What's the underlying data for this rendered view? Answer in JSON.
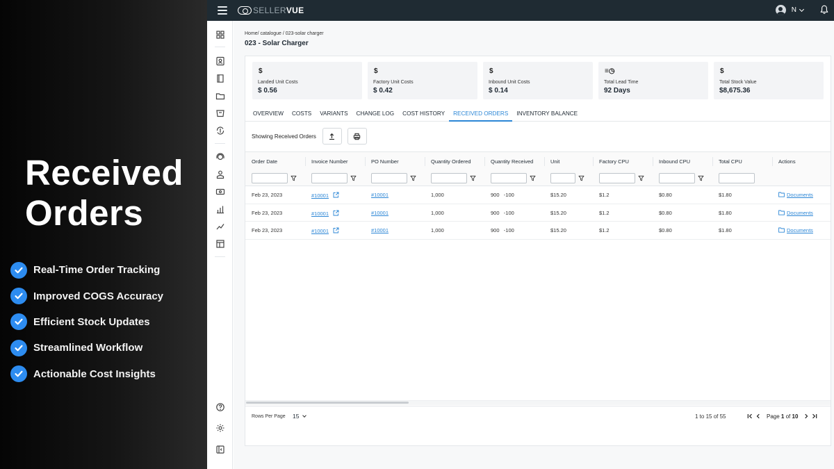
{
  "promo": {
    "title_line1": "Received",
    "title_line2": "Orders",
    "features": [
      "Real-Time Order Tracking",
      "Improved COGS Accuracy",
      "Efficient Stock Updates",
      "Streamlined Workflow",
      "Actionable Cost Insights"
    ]
  },
  "topbar": {
    "logo_light": "SELLER",
    "logo_bold": "VUE",
    "user_initial": "N"
  },
  "page": {
    "breadcrumb": "Home/ catalogue  / 023-solar charger",
    "title": "023 - Solar Charger"
  },
  "cards": [
    {
      "icon": "$",
      "label": "Landed Unit Costs",
      "value": "$ 0.56"
    },
    {
      "icon": "$",
      "label": "Factory Unit Costs",
      "value": "$ 0.42"
    },
    {
      "icon": "$",
      "label": "Inbound Unit Costs",
      "value": "$ 0.14"
    },
    {
      "icon": "≡◷",
      "label": "Total Lead Time",
      "value": "92 Days"
    },
    {
      "icon": "$",
      "label": "Total Stock Value",
      "value": "$8,675.36"
    }
  ],
  "tabs": [
    "OVERVIEW",
    "COSTS",
    "VARIANTS",
    "CHANGE LOG",
    "COST HISTORY",
    "RECEIVED ORDERS",
    "INVENTORY BALANCE"
  ],
  "active_tab": "RECEIVED ORDERS",
  "toolbar": {
    "label": "Showing Received Orders"
  },
  "table": {
    "columns": [
      "Order Date",
      "Invoice Number",
      "PO Number",
      "Quantity Ordered",
      "Quantity Received",
      "Unit",
      "Factory CPU",
      "Inbound CPU",
      "Total CPU",
      "Actions"
    ],
    "rows": [
      {
        "order_date": "Feb 23, 2023",
        "invoice": "#10001",
        "po": "#10001",
        "qty_ordered": "1,000",
        "qty_received": "900",
        "qty_diff": "-100",
        "unit": "$15.20",
        "factory_cpu": "$1.2",
        "inbound_cpu": "$0.80",
        "total_cpu": "$1.80",
        "action": "Documents"
      },
      {
        "order_date": "Feb 23, 2023",
        "invoice": "#10001",
        "po": "#10001",
        "qty_ordered": "1,000",
        "qty_received": "900",
        "qty_diff": "-100",
        "unit": "$15.20",
        "factory_cpu": "$1.2",
        "inbound_cpu": "$0.80",
        "total_cpu": "$1.80",
        "action": "Documents"
      },
      {
        "order_date": "Feb 23, 2023",
        "invoice": "#10001",
        "po": "#10001",
        "qty_ordered": "1,000",
        "qty_received": "900",
        "qty_diff": "-100",
        "unit": "$15.20",
        "factory_cpu": "$1.2",
        "inbound_cpu": "$0.80",
        "total_cpu": "$1.80",
        "action": "Documents"
      }
    ]
  },
  "footer": {
    "rows_per_page_label": "Rows Per Page",
    "rows_per_page": "15",
    "range": "1 to 15 of 55",
    "page_label": "Page",
    "page": "1",
    "of_label": "of",
    "total_pages": "10"
  },
  "colors": {
    "accent": "#2b86d6",
    "check": "#2d8cf0",
    "topbar": "#1f2b33"
  }
}
